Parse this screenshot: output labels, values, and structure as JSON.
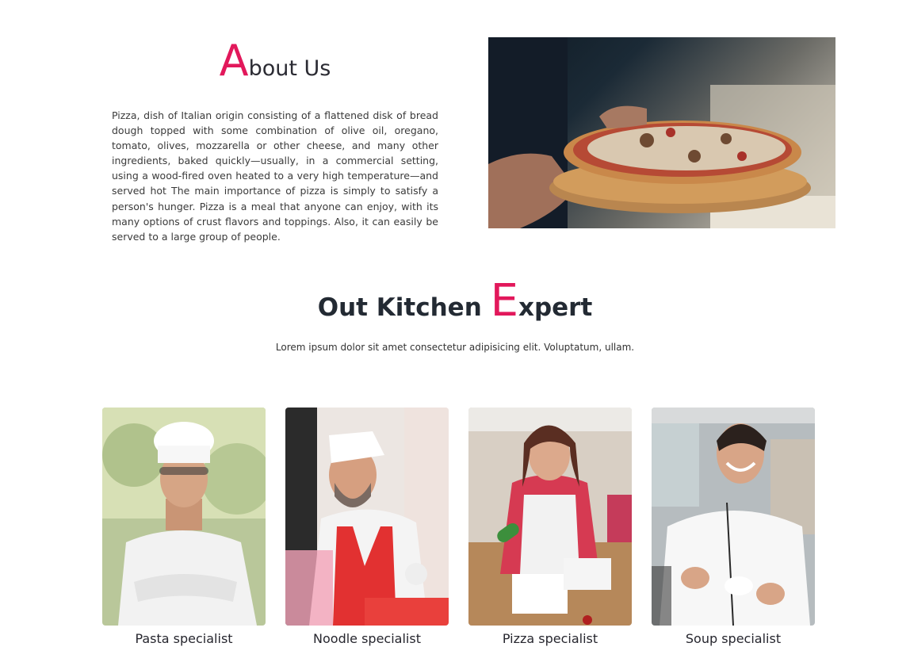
{
  "about": {
    "title_first": "A",
    "title_rest": "bout Us",
    "text": "Pizza, dish of Italian origin consisting of a flattened disk of bread dough topped with some combination of olive oil, oregano, tomato, olives, mozzarella or other cheese, and many other ingredients, baked quickly—usually, in a commercial setting, using a wood-fired oven heated to a very high temperature—and served hot The main importance of pizza is simply to satisfy a person's hunger. Pizza is a meal that anyone can enjoy, with its many options of crust flavors and toppings. Also, it can easily be served to a large group of people."
  },
  "kitchen": {
    "title_before": "Out Kitchen ",
    "title_first": "E",
    "title_rest": "xpert",
    "subtitle": "Lorem ipsum dolor sit amet consectetur adipisicing elit. Voluptatum, ullam."
  },
  "chefs": [
    {
      "name": "Pasta specialist"
    },
    {
      "name": "Noodle specialist"
    },
    {
      "name": "Pizza specialist"
    },
    {
      "name": "Soup specialist"
    }
  ],
  "colors": {
    "accent": "#e2185b",
    "heading": "#232a33"
  }
}
